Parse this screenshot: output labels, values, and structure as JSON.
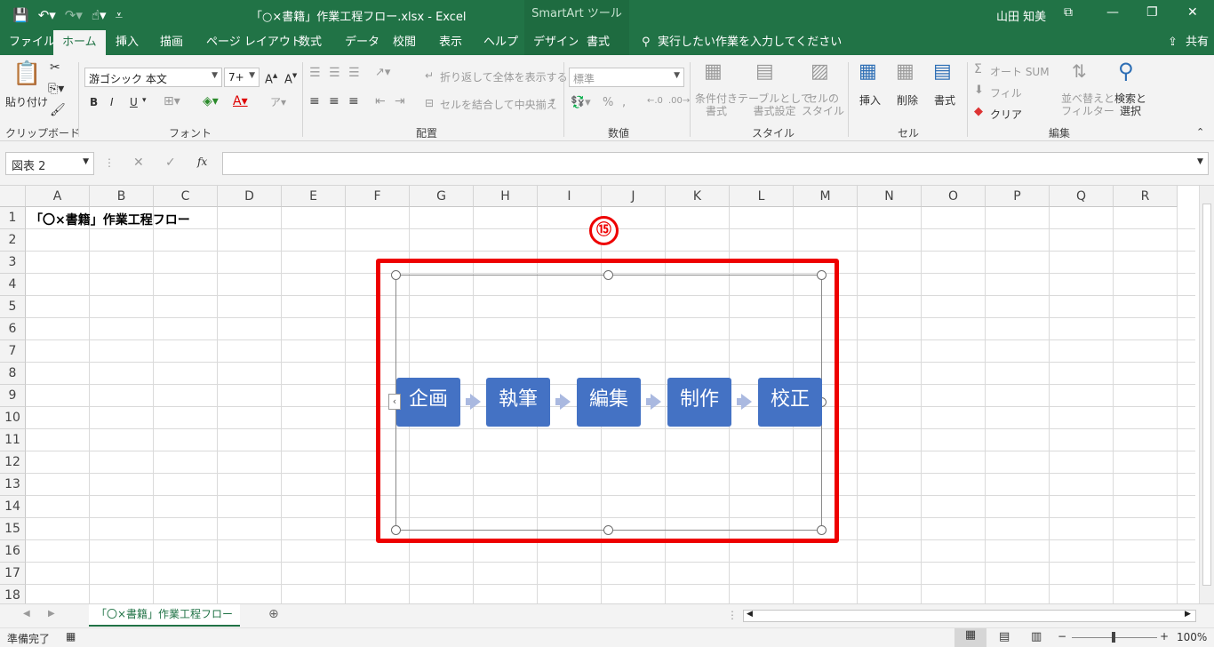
{
  "titlebar": {
    "filename": "「○×書籍」作業工程フロー.xlsx  -  Excel",
    "context_tab": "SmartArt ツール",
    "user": "山田 知美"
  },
  "menu": {
    "tabs": [
      "ファイル",
      "ホーム",
      "挿入",
      "描画",
      "ページ レイアウト",
      "数式",
      "データ",
      "校閲",
      "表示",
      "ヘルプ"
    ],
    "sa_tabs": [
      "デザイン",
      "書式"
    ],
    "tellme": "実行したい作業を入力してください",
    "share": "共有"
  },
  "ribbon": {
    "clipboard": {
      "paste": "貼り付け",
      "label": "クリップボード"
    },
    "font": {
      "name": "游ゴシック 本文",
      "size": "7+",
      "label": "フォント",
      "bold": "B",
      "italic": "I",
      "underline": "U"
    },
    "align": {
      "wrap": "折り返して全体を表示する",
      "merge": "セルを結合して中央揃え",
      "label": "配置"
    },
    "number": {
      "format": "標準",
      "label": "数値"
    },
    "styles": {
      "cond": "条件付き\n書式",
      "table": "テーブルとして\n書式設定",
      "cell": "セルの\nスタイル",
      "label": "スタイル"
    },
    "cells": {
      "insert": "挿入",
      "delete": "削除",
      "format": "書式",
      "label": "セル"
    },
    "edit": {
      "autosum": "オート SUM",
      "fill": "フィル",
      "clear": "クリア",
      "sort": "並べ替えと\nフィルター",
      "find": "検索と\n選択",
      "label": "編集"
    }
  },
  "formula": {
    "namebox": "図表 2",
    "fx": "fx",
    "cancel": "✕",
    "enter": "✓"
  },
  "columns": [
    "A",
    "B",
    "C",
    "D",
    "E",
    "F",
    "G",
    "H",
    "I",
    "J",
    "K",
    "L",
    "M",
    "N",
    "O",
    "P",
    "Q",
    "R"
  ],
  "rows": [
    "1",
    "2",
    "3",
    "4",
    "5",
    "6",
    "7",
    "8",
    "9",
    "10",
    "11",
    "12",
    "13",
    "14",
    "15",
    "16",
    "17",
    "18"
  ],
  "a1": "「〇×書籍」作業工程フロー",
  "smartart": {
    "steps": [
      "企画",
      "執筆",
      "編集",
      "制作",
      "校正"
    ],
    "badge": "⑮",
    "node_color": "#4472c4",
    "highlight_color": "#ee0000"
  },
  "sheet": {
    "tab": "「〇×書籍」作業工程フロー"
  },
  "status": {
    "ready": "準備完了",
    "zoom": "100%"
  }
}
